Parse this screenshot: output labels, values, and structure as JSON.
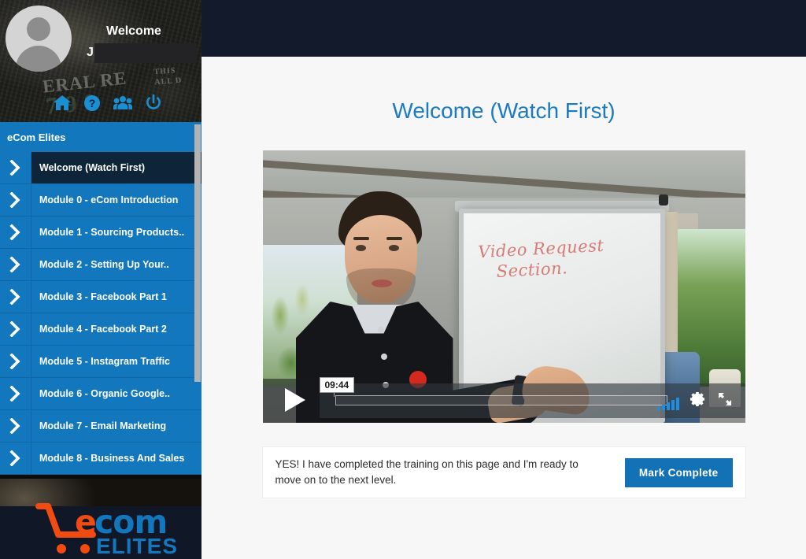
{
  "header": {
    "welcome_label": "Welcome",
    "user_name_initial": "J",
    "icons": [
      {
        "name": "home-icon",
        "label": "Home"
      },
      {
        "name": "help-circle-icon",
        "label": "Help"
      },
      {
        "name": "users-group-icon",
        "label": "Members"
      },
      {
        "name": "power-icon",
        "label": "Log Out"
      }
    ]
  },
  "sidebar": {
    "title": "eCom Elites",
    "items": [
      {
        "label": "Welcome (Watch First)",
        "active": true
      },
      {
        "label": "Module 0 - eCom Introduction",
        "active": false
      },
      {
        "label": "Module 1 - Sourcing Products..",
        "active": false
      },
      {
        "label": "Module 2 - Setting Up Your..",
        "active": false
      },
      {
        "label": "Module 3 - Facebook Part 1",
        "active": false
      },
      {
        "label": "Module 4 - Facebook Part 2",
        "active": false
      },
      {
        "label": "Module 5 - Instagram Traffic",
        "active": false
      },
      {
        "label": "Module 6 - Organic Google..",
        "active": false
      },
      {
        "label": "Module 7 - Email Marketing",
        "active": false
      },
      {
        "label": "Module 8 - Business And Sales",
        "active": false
      }
    ],
    "chevron_icon": "chevron-right-icon",
    "logo": {
      "cart_icon": "shopping-cart-icon",
      "text_e": "e",
      "text_com": "com",
      "text_elites": "ELITES",
      "color_orange": "#f24b12",
      "color_blue": "#1277bd"
    },
    "money_background_text": {
      "line1": "ERAL RE",
      "line2": "THIS\nALL D",
      "line3": "7 9 8"
    }
  },
  "main": {
    "page_title": "Welcome (Watch First)",
    "video": {
      "play_icon": "play-icon",
      "time_tooltip": "09:44",
      "volume_icon": "volume-bars-icon",
      "settings_icon": "gear-icon",
      "fullscreen_icon": "fullscreen-icon",
      "whiteboard_line1": "Video Request",
      "whiteboard_line2": "Section."
    },
    "complete": {
      "text": "YES! I have completed the training on this page and I'm ready to move on to the next level.",
      "button_label": "Mark Complete",
      "button_color": "#1272b5"
    }
  },
  "colors": {
    "sidebar_blue": "#1277bd",
    "active_navy": "#0d2439",
    "topbar_navy": "#131a2b",
    "title_blue": "#1c7bc0",
    "content_bg": "#f7f7f7"
  }
}
